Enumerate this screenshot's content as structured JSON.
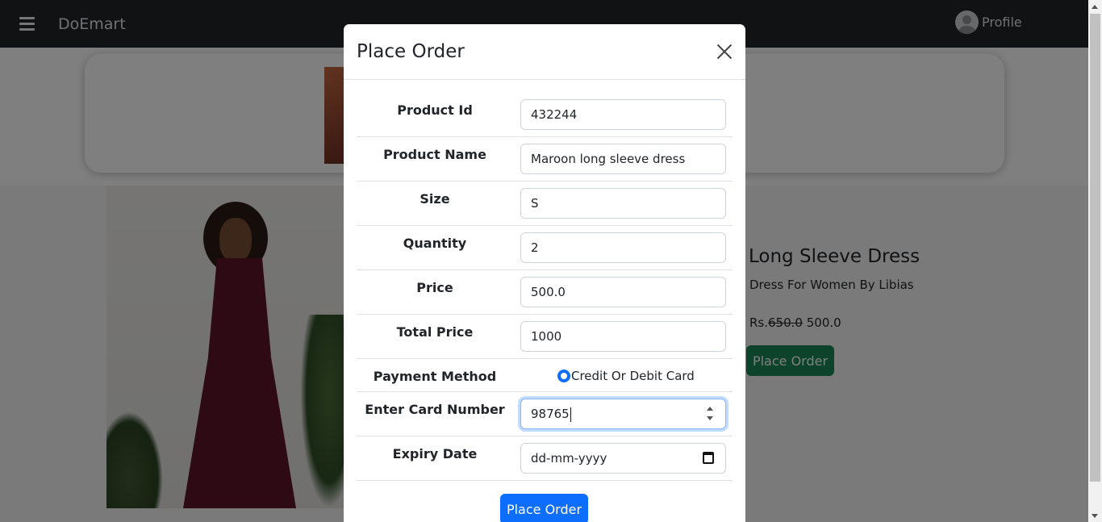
{
  "navbar": {
    "brand": "DoEmart",
    "profile_label": "Profile"
  },
  "product": {
    "title": "Long Sleeve Dress",
    "subtitle": "Dress For Women By Libias",
    "currency": "Rs.",
    "old_price": "650.0",
    "price": "500.0",
    "order_button": "Place Order"
  },
  "modal": {
    "title": "Place Order",
    "fields": [
      {
        "label": "Product Id",
        "value": "432244"
      },
      {
        "label": "Product Name",
        "value": "Maroon long sleeve dress"
      },
      {
        "label": "Size",
        "value": "S"
      },
      {
        "label": "Quantity",
        "value": "2"
      },
      {
        "label": "Price",
        "value": "500.0"
      },
      {
        "label": "Total Price",
        "value": "1000"
      }
    ],
    "payment": {
      "label": "Payment Method",
      "option": "Credit Or Debit Card"
    },
    "card": {
      "label": "Enter Card Number",
      "value": "98765"
    },
    "expiry": {
      "label": "Expiry Date",
      "placeholder": "dd-mm-yyyy"
    },
    "submit": "Place Order"
  },
  "colors": {
    "navbar": "#212529",
    "primary": "#0d6efd",
    "success": "#198754"
  }
}
